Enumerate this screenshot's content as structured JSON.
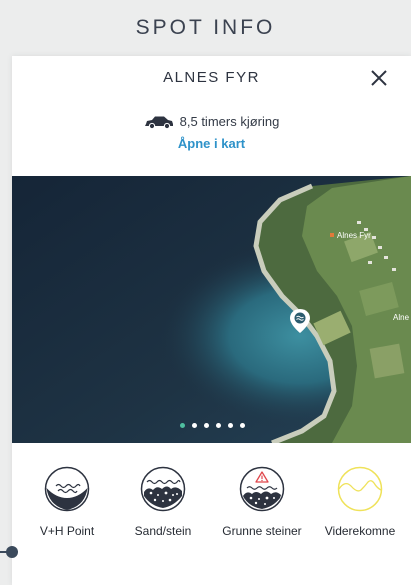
{
  "header": {
    "title": "SPOT INFO"
  },
  "spot": {
    "name": "ALNES FYR",
    "drive_time": "8,5 timers kjøring",
    "open_map_label": "Åpne i kart",
    "photo_place_label": "Alnes Fyr",
    "photo_edge_label": "Alne"
  },
  "carousel": {
    "count": 6,
    "active_index": 0
  },
  "features": [
    {
      "label": "V+H Point",
      "icon": "wave-point-icon"
    },
    {
      "label": "Sand/stein",
      "icon": "sand-stone-icon"
    },
    {
      "label": "Grunne steiner",
      "icon": "shallow-rocks-warning-icon"
    },
    {
      "label": "Viderekomne",
      "icon": "advanced-wave-icon"
    }
  ],
  "colors": {
    "accent": "#2e92c9",
    "warning": "#e0474c",
    "advanced": "#efe25a",
    "active_dot": "#4fbfa0"
  }
}
